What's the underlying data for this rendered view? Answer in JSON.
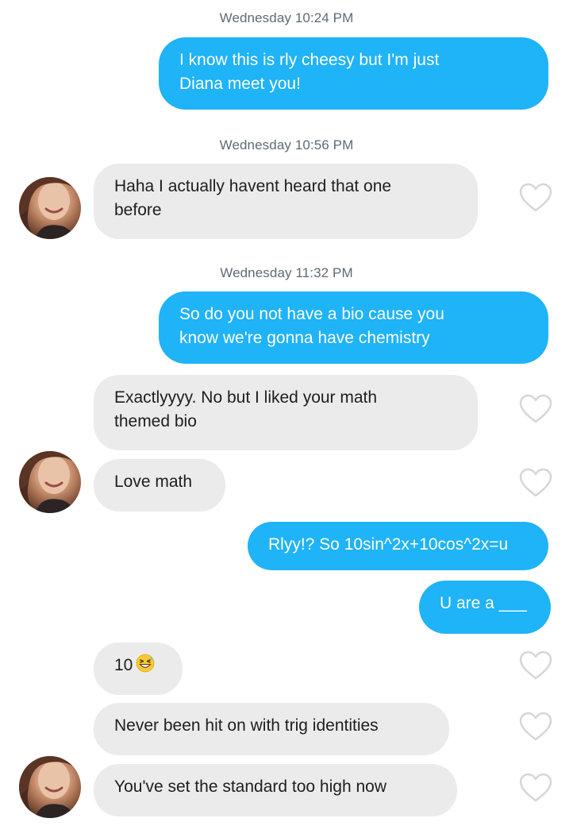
{
  "conversation": {
    "timestamps": [
      {
        "day": "Wednesday",
        "time": "10:24 PM"
      },
      {
        "day": "Wednesday",
        "time": "10:56 PM"
      },
      {
        "day": "Wednesday",
        "time": "11:32 PM"
      }
    ],
    "messages": [
      {
        "sender": "me",
        "lines": [
          "I know this is rly cheesy but I'm just",
          "Diana meet you!"
        ]
      },
      {
        "sender": "match",
        "lines": [
          "Haha I actually havent heard that one",
          "before"
        ]
      },
      {
        "sender": "me",
        "lines": [
          "So do you not have a bio cause you",
          "know we're gonna have chemistry"
        ]
      },
      {
        "sender": "match",
        "lines": [
          "Exactlyyyy. No but I liked your math",
          "themed bio"
        ]
      },
      {
        "sender": "match",
        "lines": [
          "Love math"
        ]
      },
      {
        "sender": "me",
        "lines": [
          "Rlyy!? So 10sin^2x+10cos^2x=u"
        ]
      },
      {
        "sender": "me",
        "lines": [
          "U are a ___"
        ]
      },
      {
        "sender": "match",
        "lines": [
          "10"
        ],
        "emoji": "laughing-sweat-emoji"
      },
      {
        "sender": "match",
        "lines": [
          "Never been hit on with trig identities"
        ]
      },
      {
        "sender": "match",
        "lines": [
          "You've set the standard too high now"
        ]
      }
    ]
  },
  "colors": {
    "outgoing_bubble": "#1fb3f7",
    "incoming_bubble": "#ebebeb",
    "timestamp_text": "#5f6a74",
    "heart_outline": "#d6d6d6"
  },
  "icons": {
    "like": "heart-outline-icon",
    "avatar": "match-avatar"
  }
}
